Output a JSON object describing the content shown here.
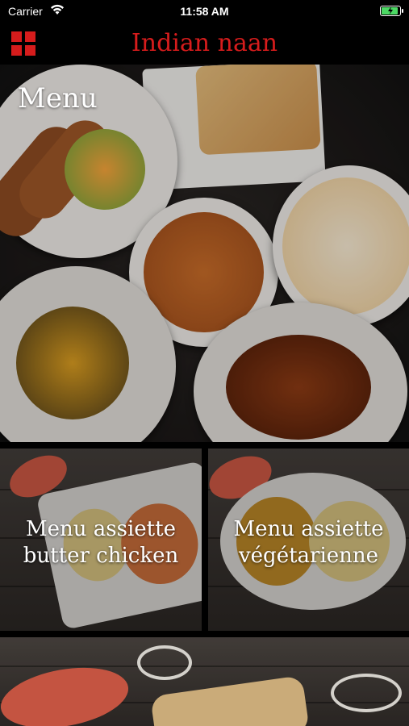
{
  "status_bar": {
    "carrier": "Carrier",
    "time": "11:58 AM",
    "battery_level": 0.85,
    "battery_color": "#4cd964"
  },
  "nav": {
    "title": "Indian naan",
    "menu_icon": "grid-icon",
    "accent_color": "#d61c1c"
  },
  "hero": {
    "label": "Menu"
  },
  "tiles": [
    {
      "label_line1": "Menu assiette",
      "label_line2": "butter chicken"
    },
    {
      "label_line1": "Menu assiette",
      "label_line2": "végétarienne"
    },
    {
      "label_line1": "",
      "label_line2": ""
    }
  ]
}
